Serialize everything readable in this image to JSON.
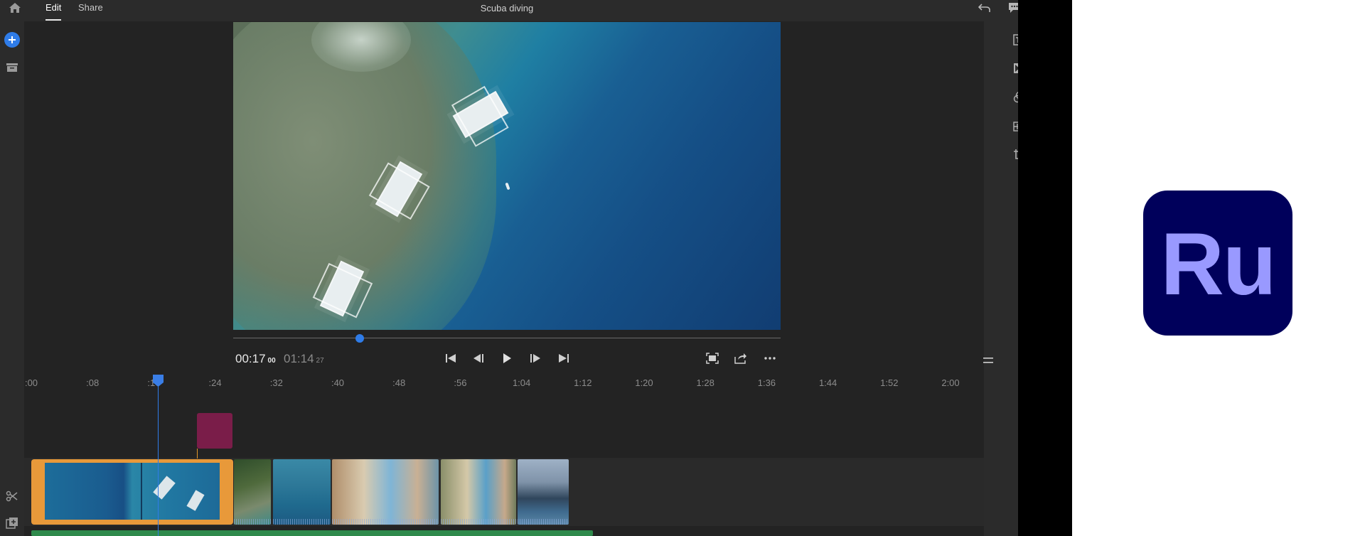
{
  "topbar": {
    "tabs": [
      {
        "label": "Edit",
        "active": true
      },
      {
        "label": "Share",
        "active": false
      }
    ],
    "project_title": "Scuba diving"
  },
  "left_rail": {
    "icons": [
      "add-media-icon",
      "library-icon",
      "split-icon",
      "duplicate-icon"
    ],
    "accent": "#2f7ce8"
  },
  "right_rail": {
    "icons": [
      "titles-icon",
      "transitions-icon",
      "color-icon",
      "audio-icon",
      "crop-icon"
    ],
    "indicator_color": "#e8902a"
  },
  "transport": {
    "current_time": "00:17",
    "current_frames": "00",
    "duration": "01:14",
    "duration_frames": "27",
    "playhead_progress": 0.23,
    "buttons": [
      "skip-to-start-icon",
      "step-back-icon",
      "play-icon",
      "step-forward-icon",
      "skip-to-end-icon"
    ],
    "tools": [
      "fit-to-screen-icon",
      "export-icon",
      "more-icon"
    ]
  },
  "timeline": {
    "ruler_labels": [
      ":00",
      ":08",
      ":16",
      ":24",
      ":32",
      ":40",
      ":48",
      ":56",
      "1:04",
      "1:12",
      "1:20",
      "1:28",
      "1:36",
      "1:44",
      "1:52",
      "2:00"
    ],
    "playhead_time": "00:17",
    "clips": [
      {
        "name": "aerial-boats-clip",
        "selected": true
      },
      {
        "name": "forest-clip",
        "selected": false
      },
      {
        "name": "underwater-clip",
        "selected": false
      },
      {
        "name": "selfie-clip-1",
        "selected": false
      },
      {
        "name": "selfie-clip-2",
        "selected": false
      },
      {
        "name": "coast-clip",
        "selected": false
      }
    ],
    "selected_clip_color": "#e8993a",
    "title_clip_color": "#7a1d49",
    "audio_track_color": "#2f8a4c"
  },
  "brand": {
    "logo_text": "Ru",
    "logo_bg": "#00005b",
    "logo_fg": "#9999ff"
  }
}
